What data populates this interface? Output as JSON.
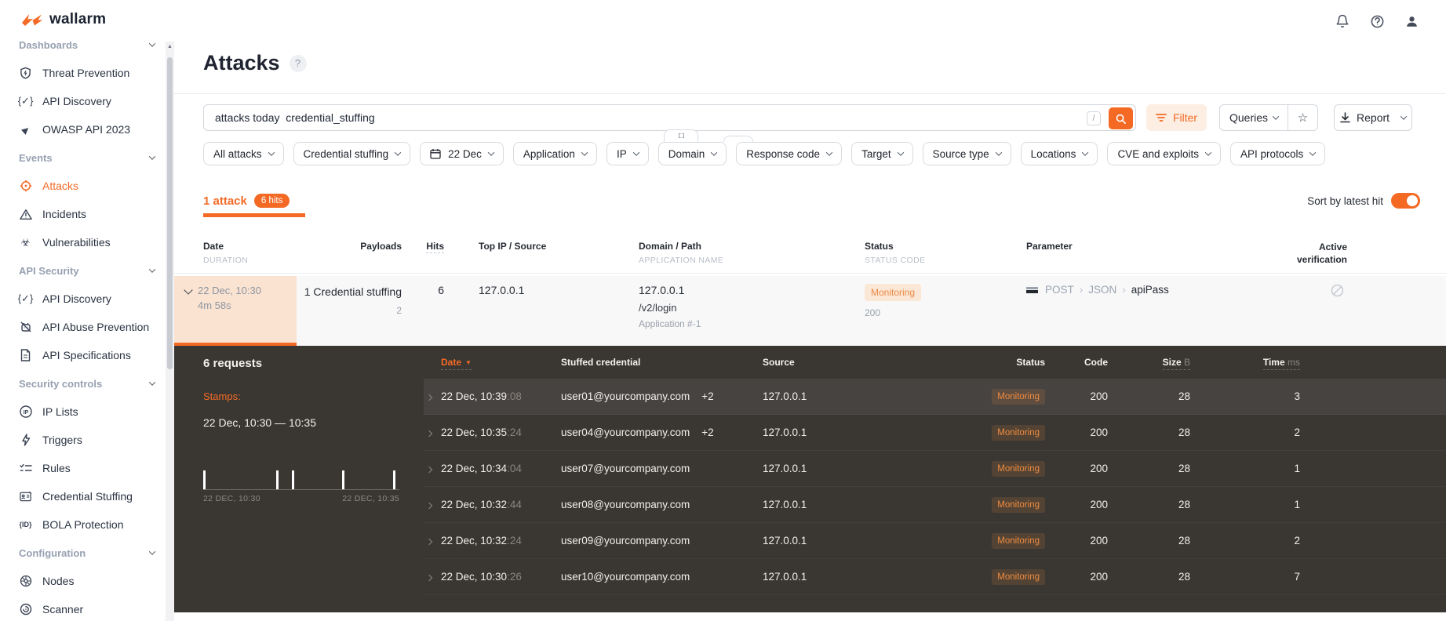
{
  "colors": {
    "accent": "#f46a25",
    "accent-soft": "#fdeee3",
    "row-orange": "#fbe3d2",
    "monitoring-bg": "#fbe7d6",
    "monitoring-text": "#ec8a44",
    "dark-bg": "#3a3733",
    "dark-row-highlight": "#474341",
    "dark-badge-text": "#ef8c3f"
  },
  "brand": {
    "name": "wallarm"
  },
  "sidebar": {
    "sections": [
      {
        "label": "Dashboards",
        "items": [
          {
            "label": "Threat Prevention"
          },
          {
            "label": "API Discovery"
          },
          {
            "label": "OWASP API 2023"
          }
        ]
      },
      {
        "label": "Events",
        "items": [
          {
            "label": "Attacks"
          },
          {
            "label": "Incidents"
          },
          {
            "label": "Vulnerabilities"
          }
        ]
      },
      {
        "label": "API Security",
        "items": [
          {
            "label": "API Discovery"
          },
          {
            "label": "API Abuse Prevention"
          },
          {
            "label": "API Specifications"
          }
        ]
      },
      {
        "label": "Security controls",
        "items": [
          {
            "label": "IP Lists"
          },
          {
            "label": "Triggers"
          },
          {
            "label": "Rules"
          },
          {
            "label": "Credential Stuffing"
          },
          {
            "label": "BOLA Protection"
          }
        ]
      },
      {
        "label": "Configuration",
        "items": [
          {
            "label": "Nodes"
          },
          {
            "label": "Scanner"
          }
        ]
      }
    ]
  },
  "page": {
    "title": "Attacks",
    "help": "?"
  },
  "search": {
    "query": "attacks today  credential_stuffing",
    "shortcut_hint": "/"
  },
  "toolbar": {
    "filter": "Filter",
    "queries": "Queries",
    "report": "Report"
  },
  "filters": [
    {
      "label": "All attacks"
    },
    {
      "label": "Credential stuffing"
    },
    {
      "label": "22 Dec"
    },
    {
      "label": "Application"
    },
    {
      "label": "IP"
    },
    {
      "label": "Domain"
    },
    {
      "label": "Response code"
    },
    {
      "label": "Target"
    },
    {
      "label": "Source type"
    },
    {
      "label": "Locations"
    },
    {
      "label": "CVE and exploits"
    },
    {
      "label": "API protocols"
    }
  ],
  "tabs": {
    "attack_tab": "1 attack",
    "hits_badge": "6 hits",
    "sort_label": "Sort by latest hit",
    "sort_enabled": true
  },
  "attacks_table": {
    "headers": {
      "date": "Date",
      "duration": "DURATION",
      "payloads": "Payloads",
      "hits": "Hits",
      "top_ip": "Top IP / Source",
      "domain": "Domain / Path",
      "application": "APPLICATION NAME",
      "status": "Status",
      "status_code": "STATUS CODE",
      "parameter": "Parameter",
      "active_verification": "Active verification"
    },
    "row": {
      "date": "22 Dec, 10:30",
      "duration": "4m 58s",
      "payloads": "1 Credential stuffing",
      "payloads_count": "2",
      "hits": "6",
      "top_ip": "127.0.0.1",
      "domain": "127.0.0.1",
      "path": "/v2/login",
      "application": "Application #-1",
      "status": "Monitoring",
      "status_code": "200",
      "parameter": {
        "method": "POST",
        "sep1": "›",
        "location": "JSON",
        "sep2": "›",
        "name": "apiPass"
      }
    }
  },
  "details": {
    "requests_count": "6 requests",
    "stamps_label": "Stamps:",
    "stamps_range": "22 Dec, 10:30 — 10:35",
    "stamps_chart": {
      "type": "bar",
      "x_start_label": "22 DEC, 10:30",
      "x_end_label": "22 DEC, 10:35",
      "bars_pct": [
        0,
        37,
        45,
        72,
        98
      ]
    },
    "headers": {
      "date": "Date",
      "sort_arrow": "▼",
      "credential": "Stuffed credential",
      "source": "Source",
      "status": "Status",
      "code": "Code",
      "size": "Size",
      "size_unit": "B",
      "time": "Time",
      "time_unit": "ms"
    },
    "rows": [
      {
        "date": "22 Dec, 10:39",
        "seconds": ":08",
        "credential": "user01@yourcompany.com",
        "extra": "+2",
        "source": "127.0.0.1",
        "status": "Monitoring",
        "code": "200",
        "size": "28",
        "time": "3"
      },
      {
        "date": "22 Dec, 10:35",
        "seconds": ":24",
        "credential": "user04@yourcompany.com",
        "extra": "+2",
        "source": "127.0.0.1",
        "status": "Monitoring",
        "code": "200",
        "size": "28",
        "time": "2"
      },
      {
        "date": "22 Dec, 10:34",
        "seconds": ":04",
        "credential": "user07@yourcompany.com",
        "extra": "",
        "source": "127.0.0.1",
        "status": "Monitoring",
        "code": "200",
        "size": "28",
        "time": "1"
      },
      {
        "date": "22 Dec, 10:32",
        "seconds": ":44",
        "credential": "user08@yourcompany.com",
        "extra": "",
        "source": "127.0.0.1",
        "status": "Monitoring",
        "code": "200",
        "size": "28",
        "time": "1"
      },
      {
        "date": "22 Dec, 10:32",
        "seconds": ":24",
        "credential": "user09@yourcompany.com",
        "extra": "",
        "source": "127.0.0.1",
        "status": "Monitoring",
        "code": "200",
        "size": "28",
        "time": "2"
      },
      {
        "date": "22 Dec, 10:30",
        "seconds": ":26",
        "credential": "user10@yourcompany.com",
        "extra": "",
        "source": "127.0.0.1",
        "status": "Monitoring",
        "code": "200",
        "size": "28",
        "time": "7"
      }
    ]
  }
}
